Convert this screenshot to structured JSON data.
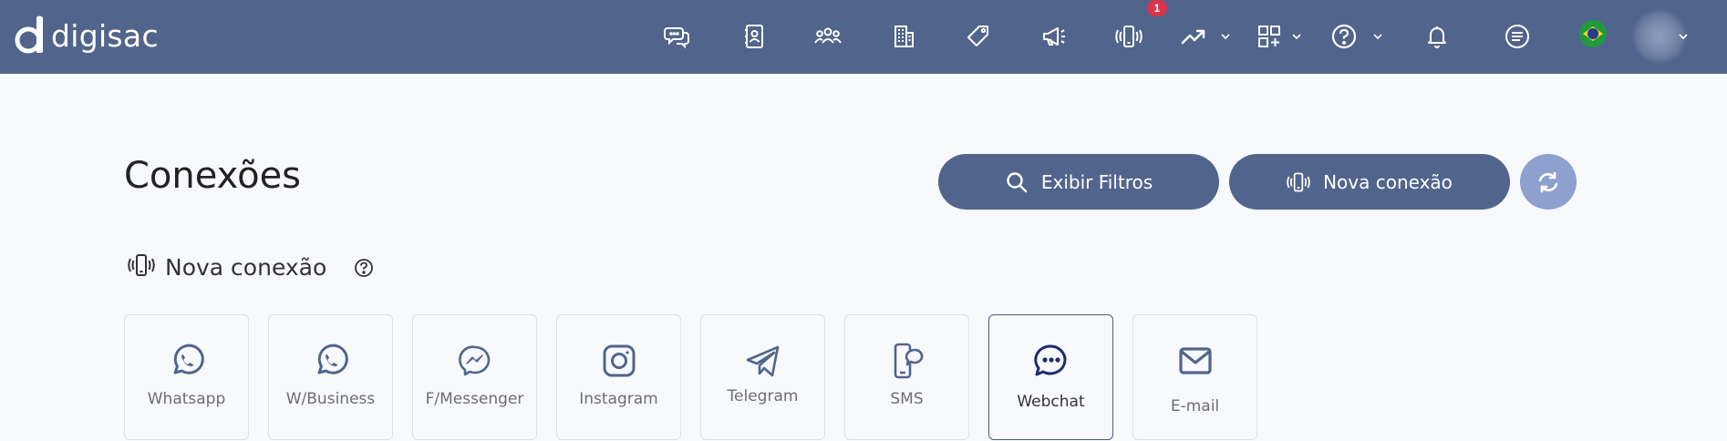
{
  "brand": {
    "name": "digisac"
  },
  "nav": {
    "items": [
      {
        "icon": "chat-bubbles-icon"
      },
      {
        "icon": "contact-book-icon"
      },
      {
        "icon": "users-group-icon"
      },
      {
        "icon": "building-icon"
      },
      {
        "icon": "tag-icon"
      },
      {
        "icon": "megaphone-icon"
      },
      {
        "icon": "vibrating-phone-icon"
      },
      {
        "icon": "trend-up-icon"
      },
      {
        "icon": "apps-grid-icon"
      },
      {
        "icon": "help-circle-icon"
      },
      {
        "icon": "bell-icon"
      },
      {
        "icon": "menu-list-icon"
      }
    ],
    "notification_badge": "1"
  },
  "page": {
    "title": "Conexões"
  },
  "actions": {
    "filter_label": "Exibir Filtros",
    "new_connection_label": "Nova conexão"
  },
  "section": {
    "title": "Nova conexão"
  },
  "connection_types": [
    {
      "label": "Whatsapp",
      "icon": "whatsapp-icon"
    },
    {
      "label": "W/Business",
      "icon": "whatsapp-business-icon"
    },
    {
      "label": "F/Messenger",
      "icon": "messenger-icon"
    },
    {
      "label": "Instagram",
      "icon": "instagram-icon"
    },
    {
      "label": "Telegram",
      "icon": "telegram-icon"
    },
    {
      "label": "SMS",
      "icon": "sms-phone-icon"
    },
    {
      "label": "Webchat",
      "icon": "webchat-icon"
    },
    {
      "label": "E-mail",
      "icon": "email-icon"
    }
  ],
  "colors": {
    "navbar": "#51658c",
    "primary_button": "#51658c",
    "refresh_button": "#8ea0cd",
    "badge": "#d9344a",
    "webchat_accent": "#1e2b6f",
    "card_icon": "#51658c"
  }
}
